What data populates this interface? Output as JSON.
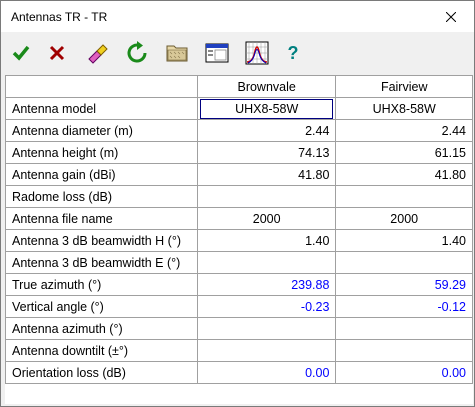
{
  "window": {
    "title": "Antennas TR - TR"
  },
  "toolbar": [
    {
      "name": "ok-check-icon"
    },
    {
      "name": "cancel-x-icon"
    },
    {
      "name": "eraser-icon"
    },
    {
      "name": "refresh-icon"
    },
    {
      "name": "folder-icon"
    },
    {
      "name": "window-icon"
    },
    {
      "name": "antenna-pattern-icon"
    },
    {
      "name": "help-icon"
    }
  ],
  "table": {
    "headers": [
      "",
      "Brownvale",
      "Fairview"
    ],
    "rows": [
      {
        "label": "Antenna model",
        "a": "UHX8-58W",
        "b": "UHX8-58W",
        "align": "ctr",
        "color": "black"
      },
      {
        "label": "Antenna diameter (m)",
        "a": "2.44",
        "b": "2.44",
        "align": "num",
        "color": "black"
      },
      {
        "label": "Antenna height (m)",
        "a": "74.13",
        "b": "61.15",
        "align": "num",
        "color": "black"
      },
      {
        "label": "Antenna gain (dBi)",
        "a": "41.80",
        "b": "41.80",
        "align": "num",
        "color": "black"
      },
      {
        "label": "Radome loss (dB)",
        "a": "",
        "b": "",
        "align": "num",
        "color": "black"
      },
      {
        "label": "Antenna file name",
        "a": "2000",
        "b": "2000",
        "align": "ctr",
        "color": "black"
      },
      {
        "label": "Antenna 3 dB beamwidth H (°)",
        "a": "1.40",
        "b": "1.40",
        "align": "num",
        "color": "black"
      },
      {
        "label": "Antenna 3 dB beamwidth E (°)",
        "a": "",
        "b": "",
        "align": "num",
        "color": "black"
      },
      {
        "label": "True azimuth (°)",
        "a": "239.88",
        "b": "59.29",
        "align": "num",
        "color": "blue"
      },
      {
        "label": "Vertical angle (°)",
        "a": "-0.23",
        "b": "-0.12",
        "align": "num",
        "color": "blue"
      },
      {
        "label": "Antenna azimuth (°)",
        "a": "",
        "b": "",
        "align": "num",
        "color": "black"
      },
      {
        "label": "Antenna downtilt (±°)",
        "a": "",
        "b": "",
        "align": "num",
        "color": "black"
      },
      {
        "label": "Orientation loss (dB)",
        "a": "0.00",
        "b": "0.00",
        "align": "num",
        "color": "blue"
      }
    ]
  },
  "colors": {
    "check": "#1a8a1a",
    "x": "#b00000",
    "blue_text": "#0000ff"
  }
}
